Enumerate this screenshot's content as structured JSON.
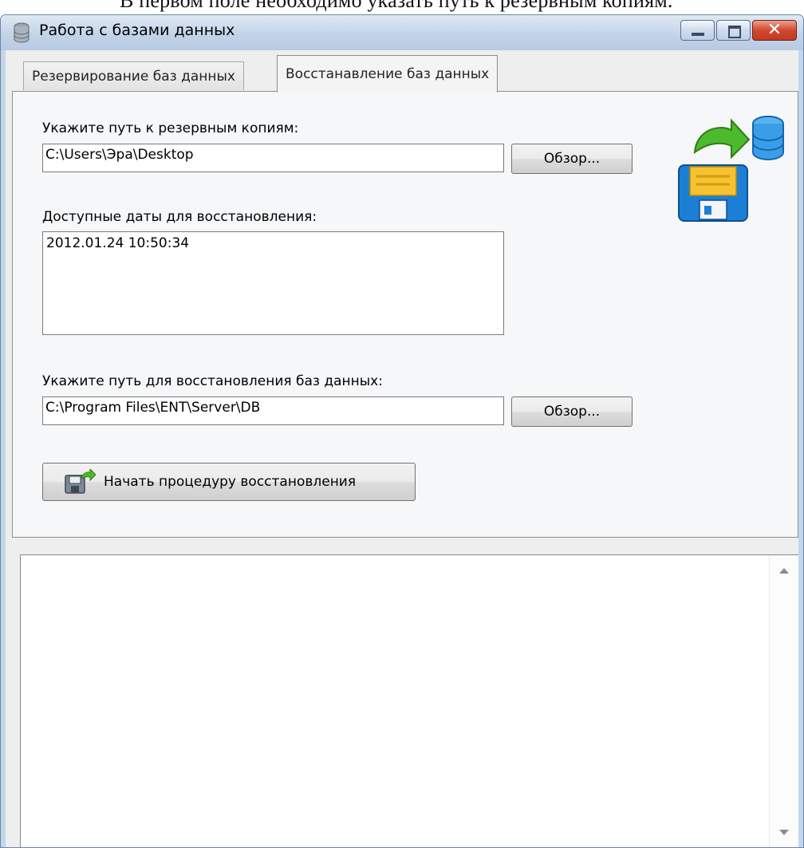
{
  "document": {
    "background_text": "В первом поле необходимо указать путь к резервным копиям."
  },
  "window": {
    "title": "Работа с базами данных",
    "icons": {
      "app": "database-icon",
      "minimize": "minimize-icon",
      "maximize": "maximize-icon",
      "close": "close-icon"
    },
    "close_glyph": "✕"
  },
  "tabs": [
    {
      "label": "Резервирование баз данных",
      "active": false
    },
    {
      "label": "Восстанавление баз данных",
      "active": true
    }
  ],
  "restore": {
    "backup_path_label": "Укажите путь к резервным копиям:",
    "backup_path_value": "C:\\Users\\Эра\\Desktop",
    "browse_label": "Обзор...",
    "dates_label": "Доступные даты для восстановления:",
    "dates": [
      "2012.01.24 10:50:34"
    ],
    "target_path_label": "Укажите путь для восстановления баз данных:",
    "target_path_value": "C:\\Program Files\\ENT\\Server\\DB",
    "start_button_label": "Начать процедуру восстановления",
    "icons": {
      "header": "restore-database-icon",
      "start": "save-arrow-icon"
    }
  },
  "log": {
    "text": ""
  },
  "colors": {
    "accent_blue": "#1c7fd6",
    "floppy_yellow": "#f5c231",
    "arrow_green": "#4cba2d"
  }
}
